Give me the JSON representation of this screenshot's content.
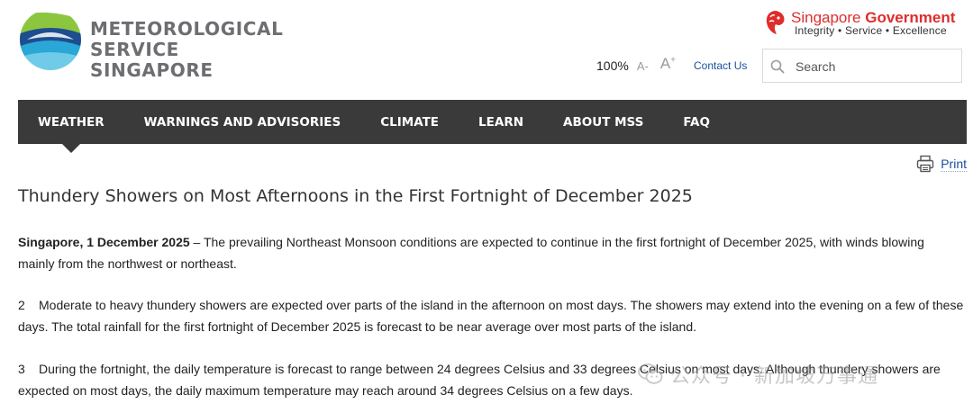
{
  "branding": {
    "logo_line1": "Meteorological",
    "logo_line2": "Service",
    "logo_line3": "Singapore",
    "gov_title_part1": "Singapore",
    "gov_title_part2": "Government",
    "gov_tagline": "Integrity • Service • Excellence"
  },
  "toolbar": {
    "zoom_level": "100%",
    "decrease_font": "A",
    "decrease_font_sup": "-",
    "increase_font": "A",
    "increase_font_sup": "+",
    "contact_link": "Contact Us",
    "search_placeholder": "Search"
  },
  "nav": {
    "items": [
      {
        "label": "WEATHER"
      },
      {
        "label": "WARNINGS AND ADVISORIES"
      },
      {
        "label": "CLIMATE"
      },
      {
        "label": "LEARN"
      },
      {
        "label": "ABOUT MSS"
      },
      {
        "label": "FAQ"
      }
    ]
  },
  "page": {
    "print_label": "Print",
    "headline": "Thundery Showers on Most Afternoons in the First Fortnight of December 2025",
    "p1_dateline": "Singapore, 1 December 2025",
    "p1_text": " – The prevailing Northeast Monsoon conditions are expected to continue in the first fortnight of December 2025, with winds blowing mainly from the northwest or northeast.",
    "p2_number": "2",
    "p2_text": "Moderate to heavy thundery showers are expected over parts of the island in the afternoon on most days. The showers may extend into the evening on a few of these days. The total rainfall for the first fortnight of December 2025 is forecast to be near average over most parts of the island.",
    "p3_number": "3",
    "p3_text": "During the fortnight, the daily temperature is forecast to range between 24 degrees Celsius and 33 degrees Celsius on most days. Although thundery showers are expected on most days, the daily maximum temperature may reach around 34 degrees Celsius on a few days."
  },
  "watermark": {
    "text": "公众号 · 新加坡万事通"
  },
  "colors": {
    "nav_bg": "#3a3a3a",
    "link": "#1a4f9c",
    "gov_red": "#de2d2d"
  }
}
